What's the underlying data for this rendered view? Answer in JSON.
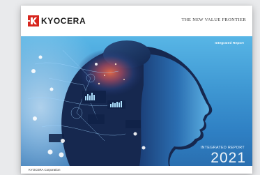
{
  "header": {
    "logo_text": "KYOCERA",
    "slogan": "The New Value Frontier"
  },
  "cover": {
    "subtitle": "Integrated Report",
    "report_title": "INTEGRATED REPORT",
    "year": "2021"
  },
  "footer": {
    "company": "KYOCERA Corporation"
  },
  "colors": {
    "brand_red": "#d7261e",
    "cover_blue": "#3f98d3"
  }
}
